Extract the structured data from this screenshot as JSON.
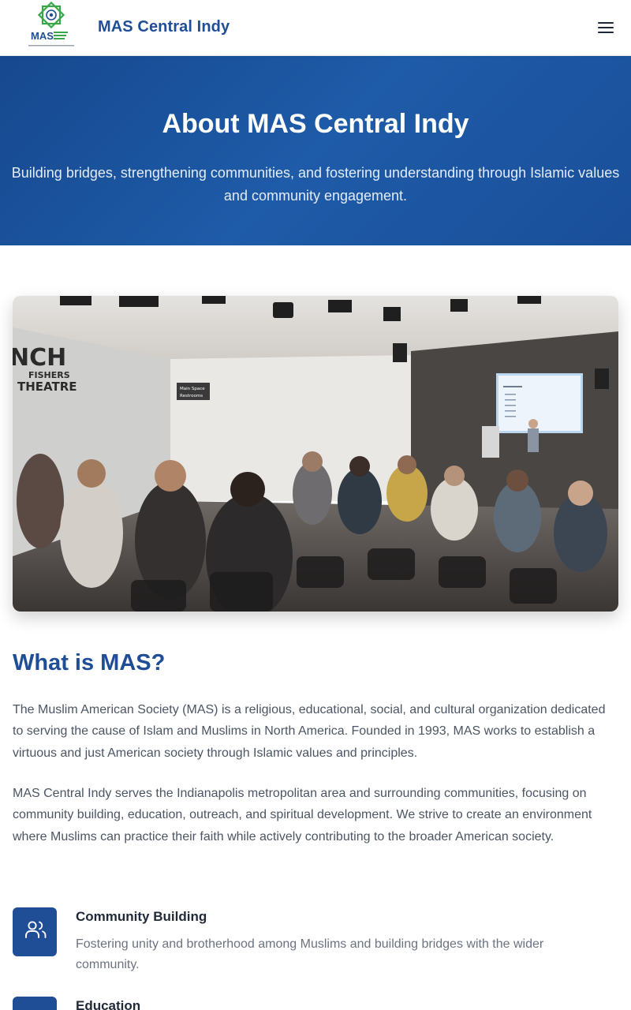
{
  "header": {
    "brand": "MAS Central Indy",
    "logo_text": "MAS",
    "menu_icon": "hamburger-menu-icon"
  },
  "hero": {
    "title": "About MAS Central Indy",
    "subtitle": "Building bridges, strengthening communities, and fostering understanding through Islamic values and community engagement."
  },
  "photo": {
    "wall_sign": [
      "NCH",
      "FISHERS",
      "THEATRE"
    ],
    "door_sign": [
      "Main Space",
      "Restrooms"
    ]
  },
  "about": {
    "title": "What is MAS?",
    "paragraph1": "The Muslim American Society (MAS) is a religious, educational, social, and cultural organization dedicated to serving the cause of Islam and Muslims in North America. Founded in 1993, MAS works to establish a virtuous and just American society through Islamic values and principles.",
    "paragraph2": "MAS Central Indy serves the Indianapolis metropolitan area and surrounding communities, focusing on community building, education, outreach, and spiritual development. We strive to create an environment where Muslims can practice their faith while actively contributing to the broader American society."
  },
  "features": [
    {
      "title": "Community Building",
      "description": "Fostering unity and brotherhood among Muslims and building bridges with the wider community.",
      "icon": "users-icon"
    },
    {
      "title": "Education",
      "description": "",
      "icon": "book-icon"
    }
  ],
  "colors": {
    "primary": "#1f4e96",
    "hero_gradient_start": "#16488e",
    "hero_gradient_end": "#1a4f9a",
    "logo_green": "#3aa64a"
  }
}
